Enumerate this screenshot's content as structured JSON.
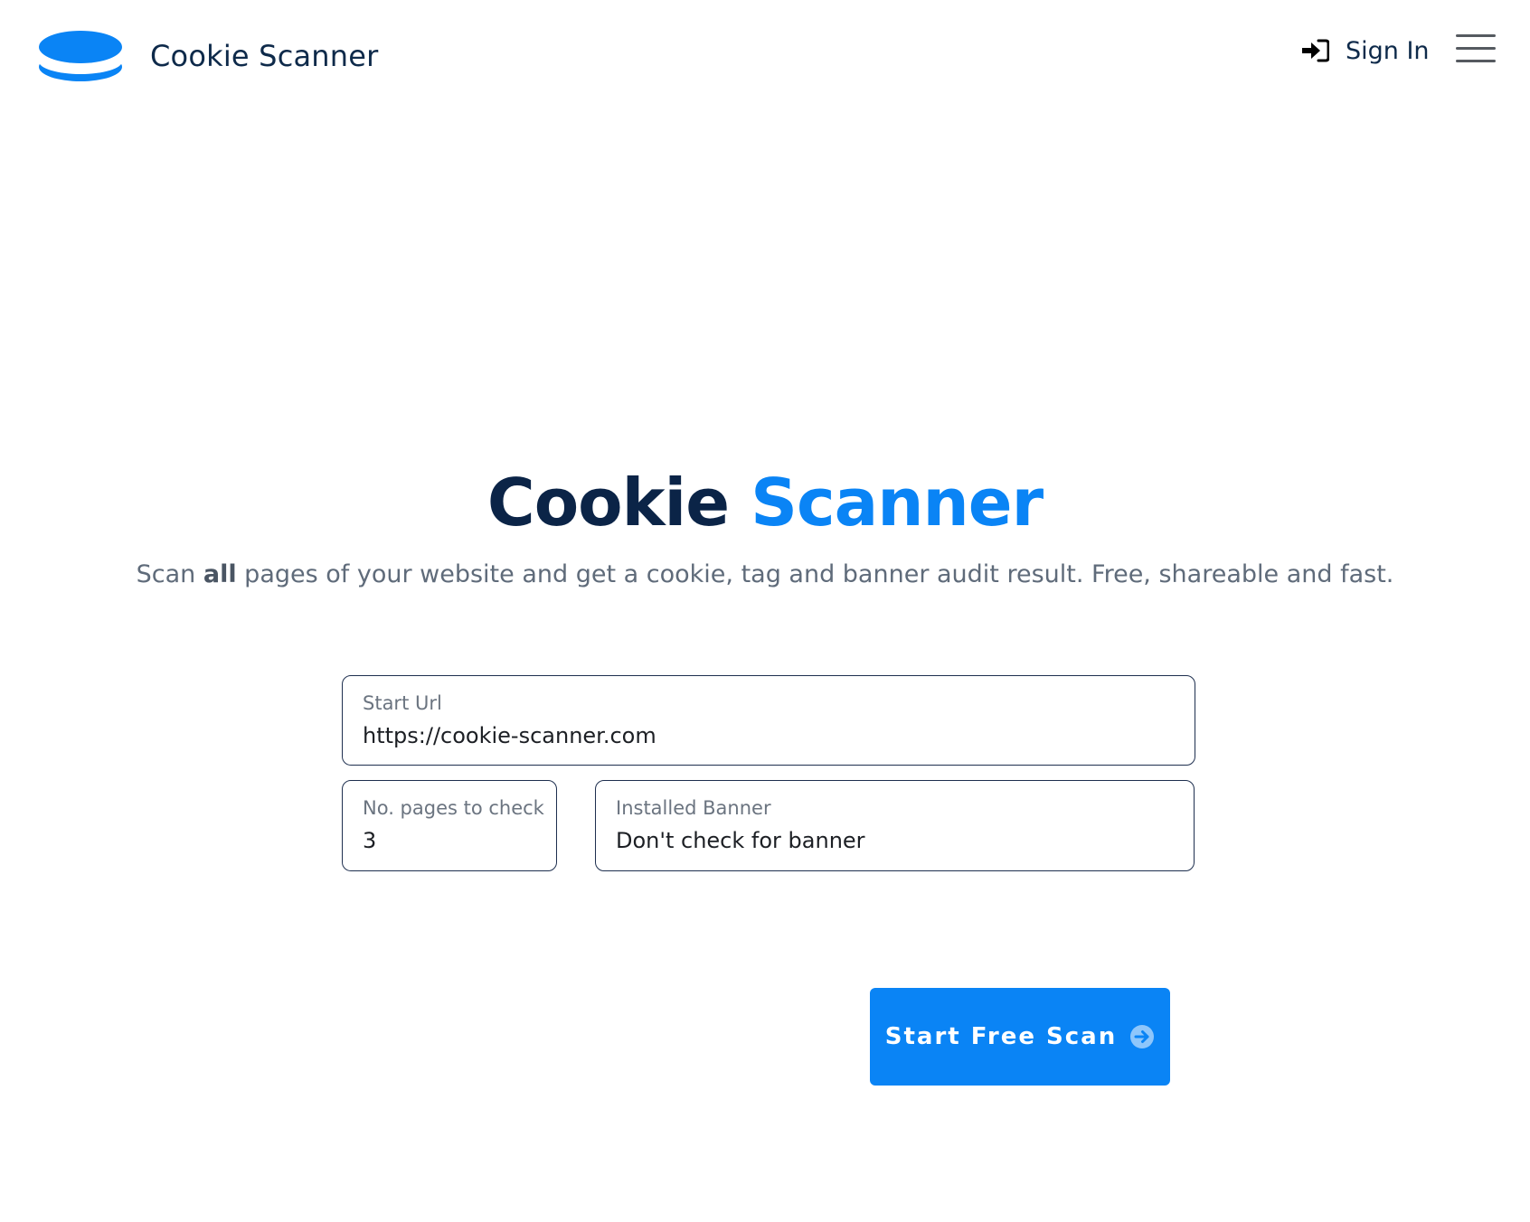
{
  "header": {
    "brand_name": "Cookie Scanner",
    "signin_label": "Sign In"
  },
  "hero": {
    "title_part1": "Cookie",
    "title_part2": "Scanner",
    "subtitle_before": "Scan ",
    "subtitle_bold": "all",
    "subtitle_after": " pages of your website and get a cookie, tag and banner audit result. Free, shareable and fast."
  },
  "form": {
    "start_url": {
      "label": "Start Url",
      "value": "https://cookie-scanner.com"
    },
    "pages": {
      "label": "No. pages to check",
      "value": "3"
    },
    "banner": {
      "label": "Installed Banner",
      "value": "Don't check for banner"
    }
  },
  "cta": {
    "label": "Start Free Scan"
  },
  "icons": {
    "logo": "cookie-stack-icon",
    "signin": "sign-in-icon",
    "menu": "hamburger-menu-icon",
    "cta": "arrow-right-circle-icon"
  },
  "colors": {
    "brand_dark": "#0b2447",
    "accent": "#0a84f5",
    "text_muted": "#5f6b7a",
    "field_border": "#1e2f4f"
  }
}
